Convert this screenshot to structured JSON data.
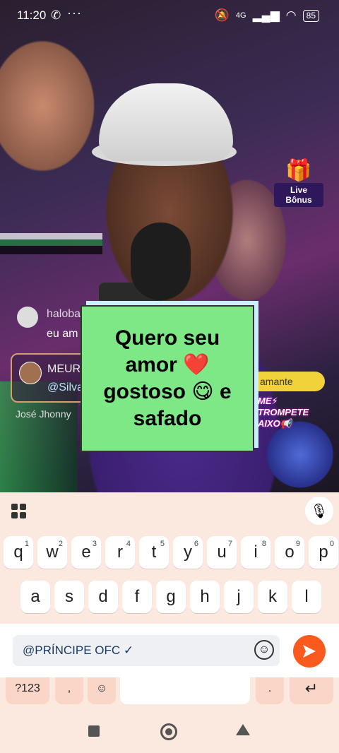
{
  "status_bar": {
    "time": "11:20",
    "whatsapp_icon": "✆",
    "more": "···",
    "battery": "85",
    "network": "4G"
  },
  "live": {
    "bonus_label": "Live Bônus"
  },
  "comments": [
    {
      "name": "haloba",
      "message": "eu am"
    },
    {
      "name": "MEURY",
      "message": "@Silva"
    },
    {
      "name": "José Jhonny",
      "message": ""
    }
  ],
  "gift_pill": "amante",
  "poster_text": [
    "ME⚡",
    "TROMPETE",
    "AIXO📢"
  ],
  "sticker": {
    "text": "Quero seu amor ❤️ gostoso 😋 e safado"
  },
  "keyboard": {
    "row1": [
      {
        "k": "q",
        "n": "1"
      },
      {
        "k": "w",
        "n": "2"
      },
      {
        "k": "e",
        "n": "3"
      },
      {
        "k": "r",
        "n": "4"
      },
      {
        "k": "t",
        "n": "5"
      },
      {
        "k": "y",
        "n": "6"
      },
      {
        "k": "u",
        "n": "7"
      },
      {
        "k": "i",
        "n": "8"
      },
      {
        "k": "o",
        "n": "9"
      },
      {
        "k": "p",
        "n": "0"
      }
    ],
    "row2": [
      "a",
      "s",
      "d",
      "f",
      "g",
      "h",
      "j",
      "k",
      "l"
    ],
    "bottom": {
      "sym": "?123",
      "comma": ",",
      "period": ".",
      "enter": "↵"
    }
  },
  "input": {
    "value": "@PRÍNCIPE OFC ✓"
  }
}
